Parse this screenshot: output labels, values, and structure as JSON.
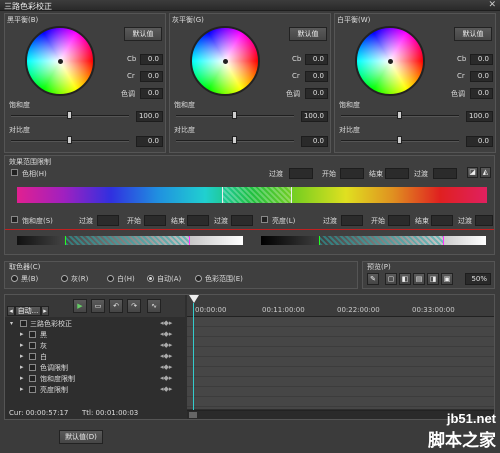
{
  "window": {
    "title": "三路色彩校正"
  },
  "wheels": [
    {
      "name": "黑平衡(B)",
      "default_label": "默认值",
      "cb": "0.0",
      "cr": "0.0",
      "hue_label": "色调",
      "hue": "0.0",
      "sat_label": "饱和度",
      "sat": "100.0",
      "contrast_label": "对比度",
      "contrast": "0.0"
    },
    {
      "name": "灰平衡(G)",
      "default_label": "默认值",
      "cb": "0.0",
      "cr": "0.0",
      "hue_label": "色调",
      "hue": "0.0",
      "sat_label": "饱和度",
      "sat": "100.0",
      "contrast_label": "对比度",
      "contrast": "0.0"
    },
    {
      "name": "白平衡(W)",
      "default_label": "默认值",
      "cb": "0.0",
      "cr": "0.0",
      "hue_label": "色调",
      "hue": "0.0",
      "sat_label": "饱和度",
      "sat": "100.0",
      "contrast_label": "对比度",
      "contrast": "0.0"
    }
  ],
  "labels": {
    "cb": "Cb",
    "cr": "Cr"
  },
  "effect": {
    "title": "效果范围限制",
    "hue_label": "色相(H)",
    "transition": "过渡",
    "start": "开始",
    "end": "结束",
    "sat_label": "饱和度(S)",
    "lum_label": "亮度(L)"
  },
  "picker": {
    "title": "取色器(C)",
    "options": [
      "黑(B)",
      "灰(R)",
      "白(H)",
      "自动(A)",
      "色彩范围(E)"
    ],
    "selected": "自动(A)"
  },
  "preview": {
    "title": "预览(P)",
    "zoom": "50%"
  },
  "timeline": {
    "track_select": "自动...",
    "ticks": [
      "00:00:00",
      "00:11:00:00",
      "00:22:00:00",
      "00:33:00:00"
    ],
    "root_label": "三路色彩校正",
    "rows": [
      "黑",
      "灰",
      "白",
      "色调限制",
      "饱和度限制",
      "亮度限制"
    ],
    "cursor": "Cur: 00:00:57:17",
    "ttl": "Ttl: 00:01:00:03"
  },
  "footer": {
    "default_button": "默认值(D)"
  },
  "watermark": {
    "line1": "jb51.net",
    "line2": "脚本之家"
  }
}
